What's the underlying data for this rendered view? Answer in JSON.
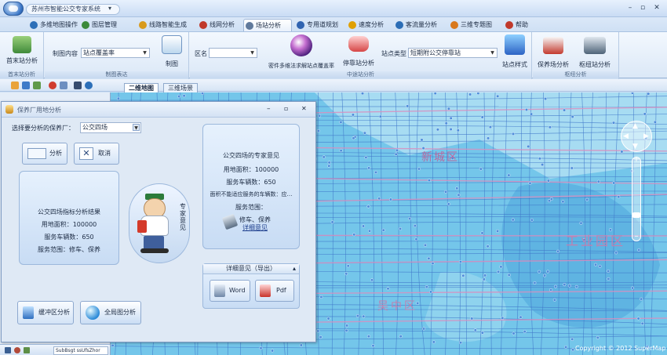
{
  "app": {
    "title": "苏州市智能公交专家系统"
  },
  "ribbon_tabs": [
    {
      "label": "多维地图操作",
      "color": "#2c6fb8"
    },
    {
      "label": "图层管理",
      "color": "#3b8a3b"
    },
    {
      "label": "线路智能生成",
      "color": "#d89a1c"
    },
    {
      "label": "线网分析",
      "color": "#c0392b"
    },
    {
      "label": "场站分析",
      "color": "#607a9c"
    },
    {
      "label": "专用道规划",
      "color": "#2f63b0"
    },
    {
      "label": "速度分析",
      "color": "#e0a000"
    },
    {
      "label": "客流量分析",
      "color": "#2b6db5"
    },
    {
      "label": "三维专题图",
      "color": "#d8781c"
    },
    {
      "label": "帮助",
      "color": "#c0392b"
    }
  ],
  "ribbon": {
    "group_first_last": {
      "button": "首末站分析",
      "label": "首末站分析"
    },
    "group_draw": {
      "content_label": "制图内容",
      "content_value": "站点覆盖率",
      "draw_button": "制图",
      "label": "制图表达"
    },
    "group_mid": {
      "zone_label": "区名",
      "zone_value": "",
      "sphere_button": "密件多维法求解站点覆盖率",
      "stop_button": "停靠站分析",
      "type_label": "站点类型",
      "type_value": "短期附公交停靠站",
      "style_button": "站点样式",
      "label": "中途站分析"
    },
    "group_depot": {
      "maintenance_button": "保养场分析",
      "depot_button": "枢纽站分析",
      "label": "枢纽分析"
    }
  },
  "map_tabs": [
    "二维地图",
    "三维场景"
  ],
  "map_labels": {
    "district_a": "新城区",
    "district_b": "工业园区",
    "district_c": "吴中区",
    "copyright": "Copyright © 2012 SuperMap"
  },
  "dialog": {
    "title": "保养厂用地分析",
    "select_label": "选择要分析的保养厂：",
    "select_value": "公交四场",
    "analyze_button": "分析",
    "cancel_button": "取消",
    "result": {
      "title": "公交四场指标分析结果",
      "area": "用地面积：100000",
      "vehicles": "服务车辆数：650",
      "scope": "服务范围：修车、保养"
    },
    "expert": {
      "side_label": "专家意见",
      "title": "公交四场的专家意见",
      "area": "用地面积：100000",
      "vehicles": "服务车辆数：650",
      "ratio": "面积不能适应服务的车辆数：应…",
      "scope_label": "服务范围：",
      "scope_value": "修车、保养",
      "detail_link": "详细意见"
    },
    "export": {
      "title": "详细意见（导出）",
      "word": "Word",
      "pdf": "Pdf"
    },
    "buffer_button": "缓冲区分析",
    "global_button": "全局图分析"
  },
  "status": {
    "text": "SubBsgt ssUfsZhor"
  }
}
